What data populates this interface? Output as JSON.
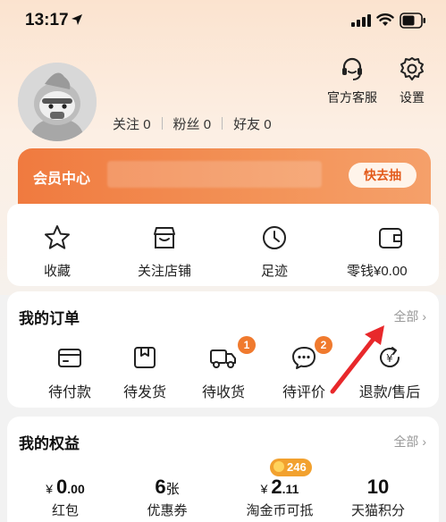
{
  "status": {
    "time": "13:17"
  },
  "profile": {
    "stats": [
      {
        "label": "关注",
        "value": "0"
      },
      {
        "label": "粉丝",
        "value": "0"
      },
      {
        "label": "好友",
        "value": "0"
      }
    ],
    "actions": {
      "service": "官方客服",
      "settings": "设置"
    }
  },
  "member": {
    "title": "会员中心",
    "button": "快去抽"
  },
  "quick": {
    "favorites": "收藏",
    "followed_shops": "关注店铺",
    "footprints": "足迹",
    "change": "零钱¥0.00"
  },
  "orders": {
    "title": "我的订单",
    "more": "全部 ›",
    "items": [
      {
        "label": "待付款"
      },
      {
        "label": "待发货"
      },
      {
        "label": "待收货",
        "badge": "1"
      },
      {
        "label": "待评价",
        "badge": "2"
      },
      {
        "label": "退款/售后"
      }
    ]
  },
  "benefits": {
    "title": "我的权益",
    "more": "全部 ›",
    "coin_badge": "246",
    "items": [
      {
        "currency": "¥",
        "int": "0",
        "dec": ".00",
        "label": "红包"
      },
      {
        "value": "6",
        "unit": "张",
        "label": "优惠券"
      },
      {
        "currency": "¥",
        "int": "2",
        "dec": ".11",
        "label": "淘金币可抵"
      },
      {
        "value": "10",
        "label": "天猫积分"
      }
    ]
  },
  "colors": {
    "accent": "#f07a2e",
    "banner": "#f07a3f",
    "arrow": "#e8282b"
  }
}
